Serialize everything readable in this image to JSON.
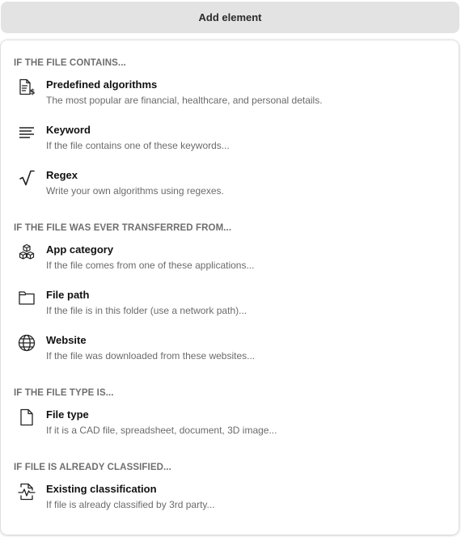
{
  "add_element_label": "Add element",
  "sections": [
    {
      "title": "IF THE FILE CONTAINS...",
      "items": [
        {
          "title": "Predefined algorithms",
          "description": "The most popular are financial, healthcare, and personal details.",
          "icon": "document-money-icon"
        },
        {
          "title": "Keyword",
          "description": "If the file contains one of these keywords...",
          "icon": "text-lines-icon"
        },
        {
          "title": "Regex",
          "description": "Write your own algorithms using regexes.",
          "icon": "square-root-icon"
        }
      ]
    },
    {
      "title": "IF THE FILE WAS EVER TRANSFERRED FROM...",
      "items": [
        {
          "title": "App category",
          "description": "If the file comes from one of these applications...",
          "icon": "cubes-icon"
        },
        {
          "title": "File path",
          "description": "If the file is in this folder (use a network path)...",
          "icon": "folder-icon"
        },
        {
          "title": "Website",
          "description": "If the file was downloaded from these websites...",
          "icon": "globe-icon"
        }
      ]
    },
    {
      "title": "IF THE FILE TYPE IS...",
      "items": [
        {
          "title": "File type",
          "description": "If it is a CAD file, spreadsheet, document, 3D image...",
          "icon": "file-icon"
        }
      ]
    },
    {
      "title": "IF FILE IS ALREADY CLASSIFIED...",
      "items": [
        {
          "title": "Existing classification",
          "description": "If file is already classified by 3rd party...",
          "icon": "document-pulse-icon"
        }
      ]
    }
  ]
}
